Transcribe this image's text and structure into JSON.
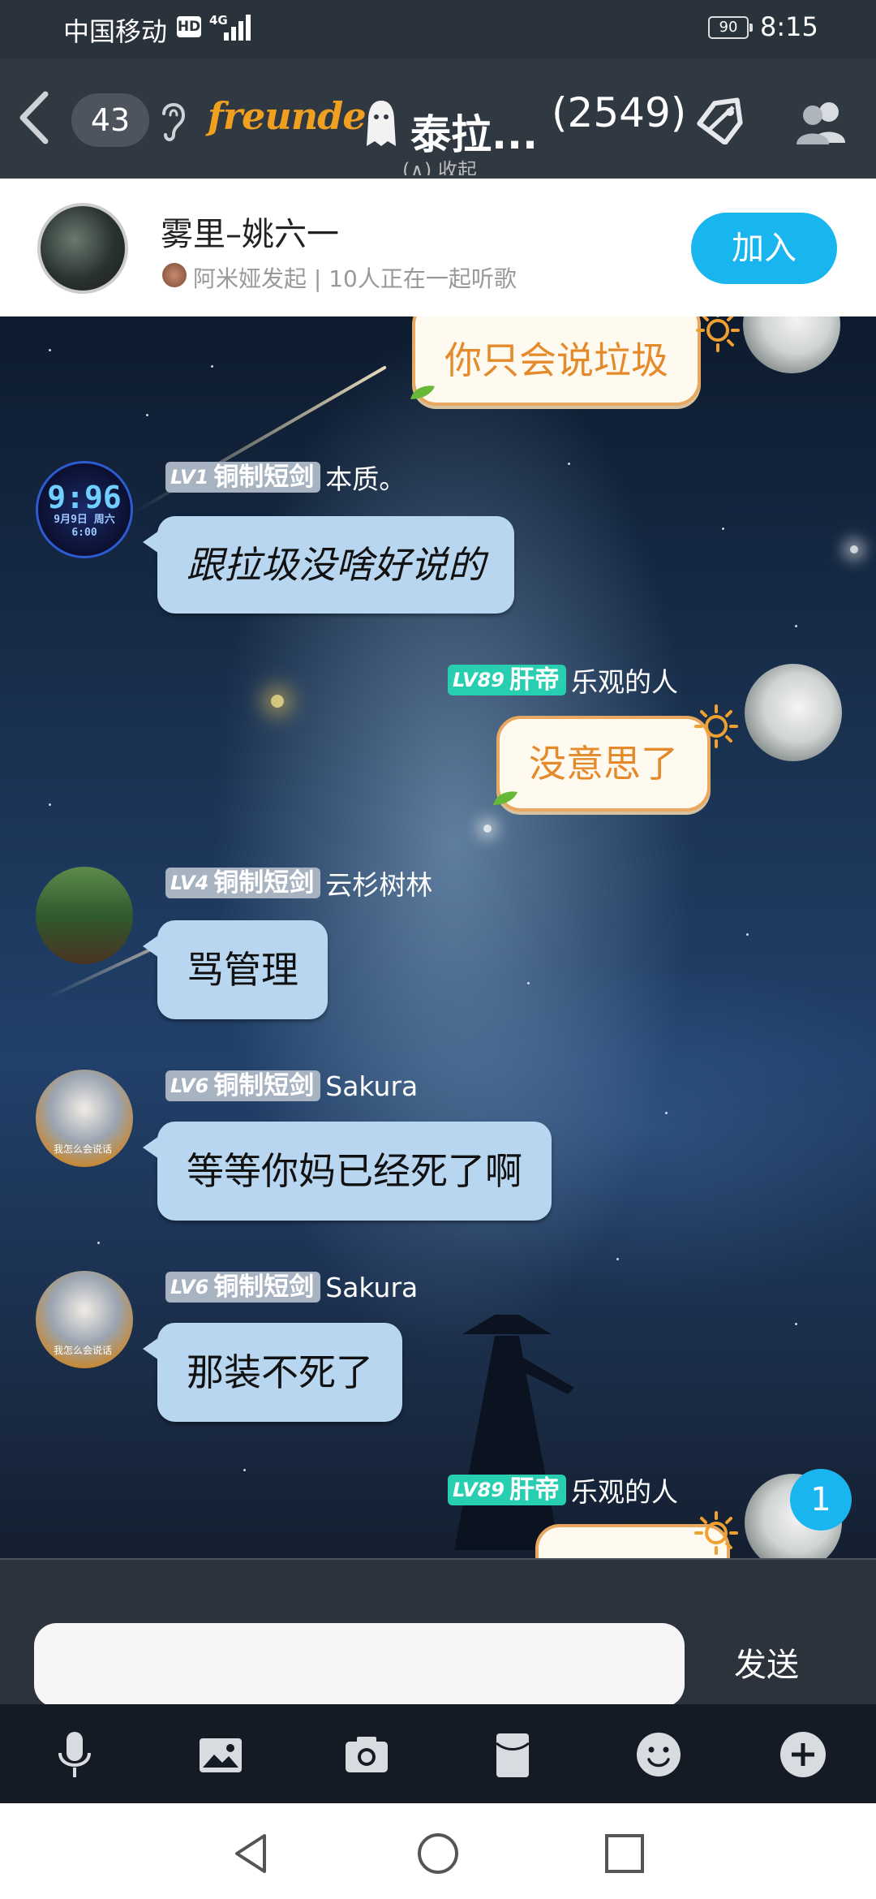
{
  "status_bar": {
    "carrier": "中国移动",
    "hd": "HD",
    "network": "4G",
    "battery": "90",
    "time": "8:15"
  },
  "header": {
    "unread_count": "43",
    "logo_text": "freunde",
    "group_name": "泰拉...",
    "group_sub": "(∧) 收起",
    "member_count": "(2549)"
  },
  "music": {
    "song_title": "雾里–姚六一",
    "meta": "阿米娅发起 | 10人正在一起听歌",
    "join_label": "加入"
  },
  "messages": [
    {
      "sender": "",
      "text": "你只会说垃圾",
      "side": "right",
      "style": "paper"
    },
    {
      "level": "LV1",
      "rank": "铜制短剑",
      "sender": "本质。",
      "text": "跟拉圾没啥好说的",
      "side": "left",
      "avatar_text": "9:96",
      "avatar_sub": "9月9日 周六 6:00"
    },
    {
      "level": "LV89",
      "rank": "肝帝",
      "sender": "乐观的人",
      "text": "没意思了",
      "side": "right",
      "style": "paper"
    },
    {
      "level": "LV4",
      "rank": "铜制短剑",
      "sender": "云杉树林",
      "text": "骂管理",
      "side": "left"
    },
    {
      "level": "LV6",
      "rank": "铜制短剑",
      "sender": "Sakura",
      "text": "等等你妈已经死了啊",
      "side": "left"
    },
    {
      "level": "LV6",
      "rank": "铜制短剑",
      "sender": "Sakura",
      "text": "那装不死了",
      "side": "left"
    },
    {
      "level": "LV89",
      "rank": "肝帝",
      "sender": "乐观的人",
      "text": "",
      "side": "right",
      "style": "paper"
    }
  ],
  "new_message_badge": "1",
  "input": {
    "placeholder": "",
    "value": "",
    "send_label": "发送"
  },
  "toolbar_icons": [
    "microphone-icon",
    "image-icon",
    "camera-icon",
    "red-packet-icon",
    "emoji-icon",
    "plus-icon"
  ],
  "colors": {
    "accent": "#19b5ef",
    "level_gray": "#a8b3c2",
    "level_teal": "#27cfb0",
    "bubble_blue": "#b9d6f1",
    "paper_border": "#e8a860"
  }
}
